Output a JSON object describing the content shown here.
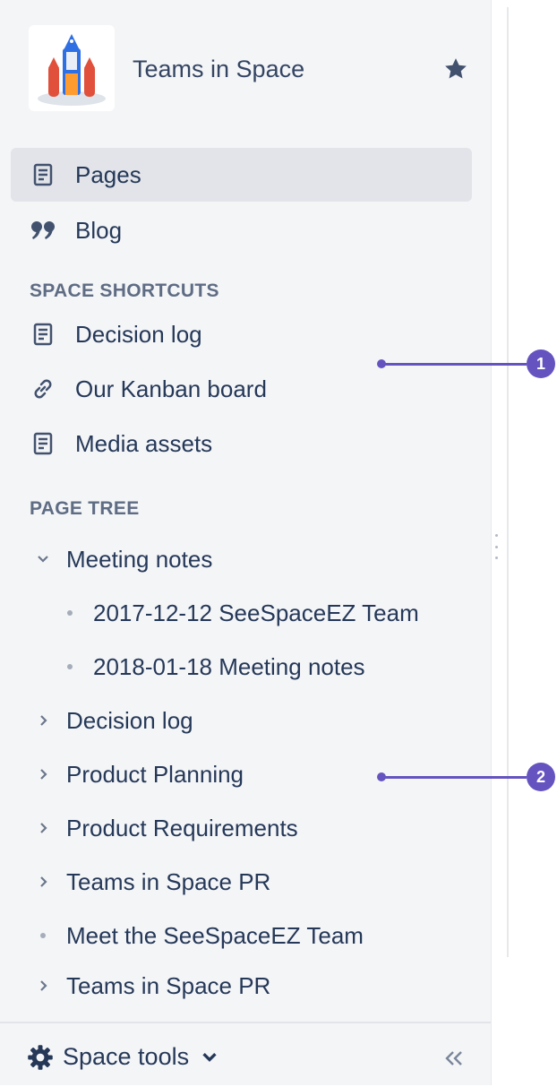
{
  "space": {
    "name": "Teams in Space"
  },
  "nav": {
    "items": [
      {
        "label": "Pages",
        "icon": "page-icon",
        "selected": true
      },
      {
        "label": "Blog",
        "icon": "quote-icon",
        "selected": false
      }
    ]
  },
  "shortcuts": {
    "title": "SPACE SHORTCUTS",
    "items": [
      {
        "label": "Decision log",
        "icon": "page-icon"
      },
      {
        "label": "Our Kanban board",
        "icon": "link-icon"
      },
      {
        "label": "Media assets",
        "icon": "page-icon"
      }
    ]
  },
  "page_tree": {
    "title": "PAGE TREE",
    "items": [
      {
        "label": "Meeting notes",
        "twisty": "chevron-down"
      },
      {
        "label": "2017-12-12 SeeSpaceEZ Team",
        "twisty": "bullet"
      },
      {
        "label": "2018-01-18 Meeting notes",
        "twisty": "bullet"
      },
      {
        "label": "Decision log",
        "twisty": "chevron-right"
      },
      {
        "label": "Product Planning",
        "twisty": "chevron-right"
      },
      {
        "label": "Product Requirements",
        "twisty": "chevron-right"
      },
      {
        "label": "Teams in Space PR",
        "twisty": "chevron-right"
      },
      {
        "label": "Meet the SeeSpaceEZ Team",
        "twisty": "bullet"
      },
      {
        "label": "Teams in Space PR",
        "twisty": "chevron-right"
      }
    ]
  },
  "footer": {
    "space_tools_label": "Space tools"
  },
  "callouts": [
    "1",
    "2"
  ],
  "colors": {
    "sidebar_bg": "#f4f5f7",
    "selected_bg": "#e2e4e9",
    "callout": "#6554c0",
    "text": "#253858"
  }
}
